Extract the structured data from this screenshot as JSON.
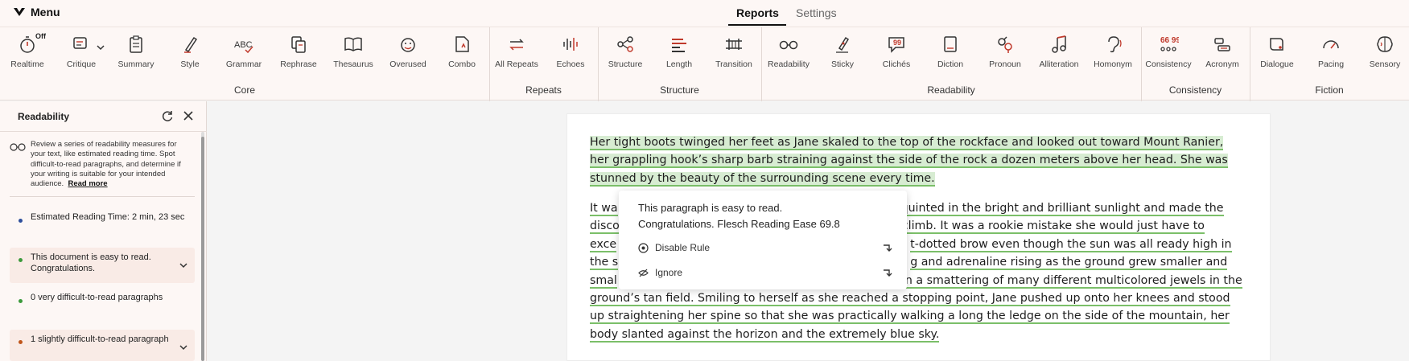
{
  "topbar": {
    "menu_label": "Menu",
    "tabs": [
      {
        "label": "Reports",
        "active": true
      },
      {
        "label": "Settings",
        "active": false
      }
    ]
  },
  "toolbar": {
    "realtime_badge": "Off",
    "tools": [
      {
        "label": "Realtime",
        "icon": "stopwatch-icon"
      },
      {
        "label": "Critique",
        "icon": "critique-icon"
      },
      {
        "label": "Summary",
        "icon": "clipboard-icon"
      },
      {
        "label": "Style",
        "icon": "pen-icon"
      },
      {
        "label": "Grammar",
        "icon": "abc-check-icon"
      },
      {
        "label": "Rephrase",
        "icon": "rephrase-icon"
      },
      {
        "label": "Thesaurus",
        "icon": "book-icon"
      },
      {
        "label": "Overused",
        "icon": "face-icon"
      },
      {
        "label": "Combo",
        "icon": "combo-doc-icon"
      },
      {
        "label": "All Repeats",
        "icon": "arrows-repeat-icon"
      },
      {
        "label": "Echoes",
        "icon": "soundwave-icon"
      },
      {
        "label": "Structure",
        "icon": "nodes-icon"
      },
      {
        "label": "Length",
        "icon": "bars-length-icon"
      },
      {
        "label": "Transition",
        "icon": "bridge-icon"
      },
      {
        "label": "Readability",
        "icon": "glasses-icon"
      },
      {
        "label": "Sticky",
        "icon": "sticky-pen-icon"
      },
      {
        "label": "Clichés",
        "icon": "quote-bubble-icon"
      },
      {
        "label": "Diction",
        "icon": "dictionary-icon"
      },
      {
        "label": "Pronoun",
        "icon": "gender-icon"
      },
      {
        "label": "Alliteration",
        "icon": "music-note-icon"
      },
      {
        "label": "Homonym",
        "icon": "ear-icon"
      },
      {
        "label": "Consistency",
        "icon": "consistency-dots-icon"
      },
      {
        "label": "Acronym",
        "icon": "acronym-icon"
      },
      {
        "label": "Dialogue",
        "icon": "dialogue-bubble-icon"
      },
      {
        "label": "Pacing",
        "icon": "speedometer-icon"
      },
      {
        "label": "Sensory",
        "icon": "brain-icon"
      }
    ],
    "groups": [
      {
        "label": "Core"
      },
      {
        "label": "Repeats"
      },
      {
        "label": "Structure"
      },
      {
        "label": "Readability"
      },
      {
        "label": "Consistency"
      },
      {
        "label": "Fiction"
      }
    ]
  },
  "sidebar": {
    "title": "Readability",
    "intro": "Review a series of readability measures for your text, like estimated reading time. Spot difficult-to-read paragraphs, and determine if your writing is suitable for your intended audience.",
    "read_more": "Read more",
    "items": [
      {
        "text": "Estimated Reading Time: 2 min, 23 sec",
        "dot_color": "#2e4f9c",
        "expandable": false
      },
      {
        "text": "This document is easy to read. Congratulations.",
        "dot_color": "#3c9a3c",
        "expandable": true
      },
      {
        "text": "0 very difficult-to-read paragraphs",
        "dot_color": "#3c9a3c",
        "expandable": false
      },
      {
        "text": "1 slightly difficult-to-read paragraph",
        "dot_color": "#c0561c",
        "expandable": true
      }
    ]
  },
  "document": {
    "paragraph1": [
      "Her tight boots twinged her feet as Jane skaled to the top of the rockface and looked out toward Mount Ranier,",
      "her grappling hook’s sharp barb straining against the side of the rock a dozen meters above her head. She was",
      "stunned by the beauty of the surrounding scene every time."
    ],
    "paragraph2": [
      "It wa",
      "disco",
      "exce",
      "the s",
      "smal",
      "ground’s tan field. Smiling to herself as she reached a stopping point, Jane pushed up onto her knees and stood",
      "up straightening her spine so that she was practically walking a long the ledge on the side of the mountain, her",
      "body slanted against the horizon and the extremely blue sky."
    ],
    "paragraph2_right": [
      "quinted in the bright and brilliant sunlight and made the",
      "climb. It was a rookie mistake she would just have to",
      "t-dotted brow even though the sun was all ready high in",
      "g and adrenaline rising as the ground grew smaller and",
      "n a smattering of many different multicolored jewels in the"
    ]
  },
  "popover": {
    "line1": "This paragraph is easy to read.",
    "line2": "Congratulations. Flesch Reading Ease 69.8",
    "disable_rule": "Disable Rule",
    "ignore": "Ignore"
  },
  "colors": {
    "accent": "#c0392b",
    "highlight_green": "#d7ecd2",
    "underline_green": "#7bbf69",
    "panel_bg": "#fdf7f5"
  }
}
